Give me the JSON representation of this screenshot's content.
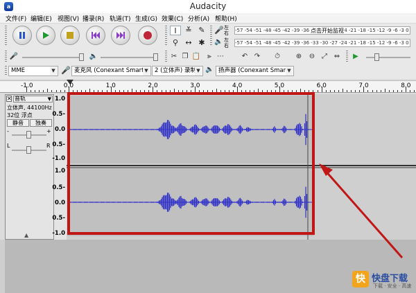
{
  "window": {
    "title": "Audacity",
    "icon": "audacity-icon"
  },
  "menu": [
    "文件(F)",
    "编辑(E)",
    "视图(V)",
    "播录(R)",
    "轨道(T)",
    "生成(G)",
    "效果(C)",
    "分析(A)",
    "帮助(H)"
  ],
  "transport": {
    "pause": "pause-icon",
    "play": "play-icon",
    "stop": "stop-icon",
    "skip_start": "skip-start-icon",
    "skip_end": "skip-end-icon",
    "record": "record-icon"
  },
  "meters": {
    "record_label": "左右",
    "record_scale": "-57 -54 -51 -48 -45 -42 -39 -36 -33 -30 -27 -24 -21 -18 -15 -12 -9 -6 -3 0",
    "record_prompt": "点击开始监视",
    "record_scale_right": "4 -21 -18 -15 -12 -9 -6 -3 0",
    "play_label": "左右",
    "play_scale": "-57 -54 -51 -48 -45 -42 -39 -36 -33 -30 -27 -24 -21 -18 -15 -12 -9 -6 -3 0"
  },
  "devices": {
    "host": "MME",
    "input": "麦克风 (Conexant SmartA",
    "channels": "2 (立体声) 录制",
    "output": "扬声器 (Conexant SmartA"
  },
  "ruler": {
    "ticks": [
      "-1.0",
      "0.0",
      "1.0",
      "2.0",
      "3.0",
      "4.0",
      "5.0",
      "6.0",
      "7.0",
      "8.0"
    ]
  },
  "track": {
    "name": "音轨",
    "info_line1": "立体声, 44100Hz",
    "info_line2": "32位 浮点",
    "mute": "静音",
    "solo": "独奏",
    "gain_minus": "-",
    "gain_plus": "+",
    "pan_left": "L",
    "pan_right": "R"
  },
  "vertical_scale": {
    "top_channel": [
      "1.0",
      "0.5-",
      "0.0",
      "0.5-",
      "-1.0"
    ],
    "bottom_channel": [
      "1.0",
      "0.5-",
      "0.0",
      "0.5-",
      "-1.0"
    ]
  },
  "waveform": {
    "color": "#3232c8",
    "clip_seconds": 5.85
  },
  "annotation": {
    "frame_color": "#c11616",
    "arrow_color": "#c11616"
  },
  "watermark": {
    "text": "快盘下载",
    "sub": "下载 · 安全 · 高速"
  }
}
